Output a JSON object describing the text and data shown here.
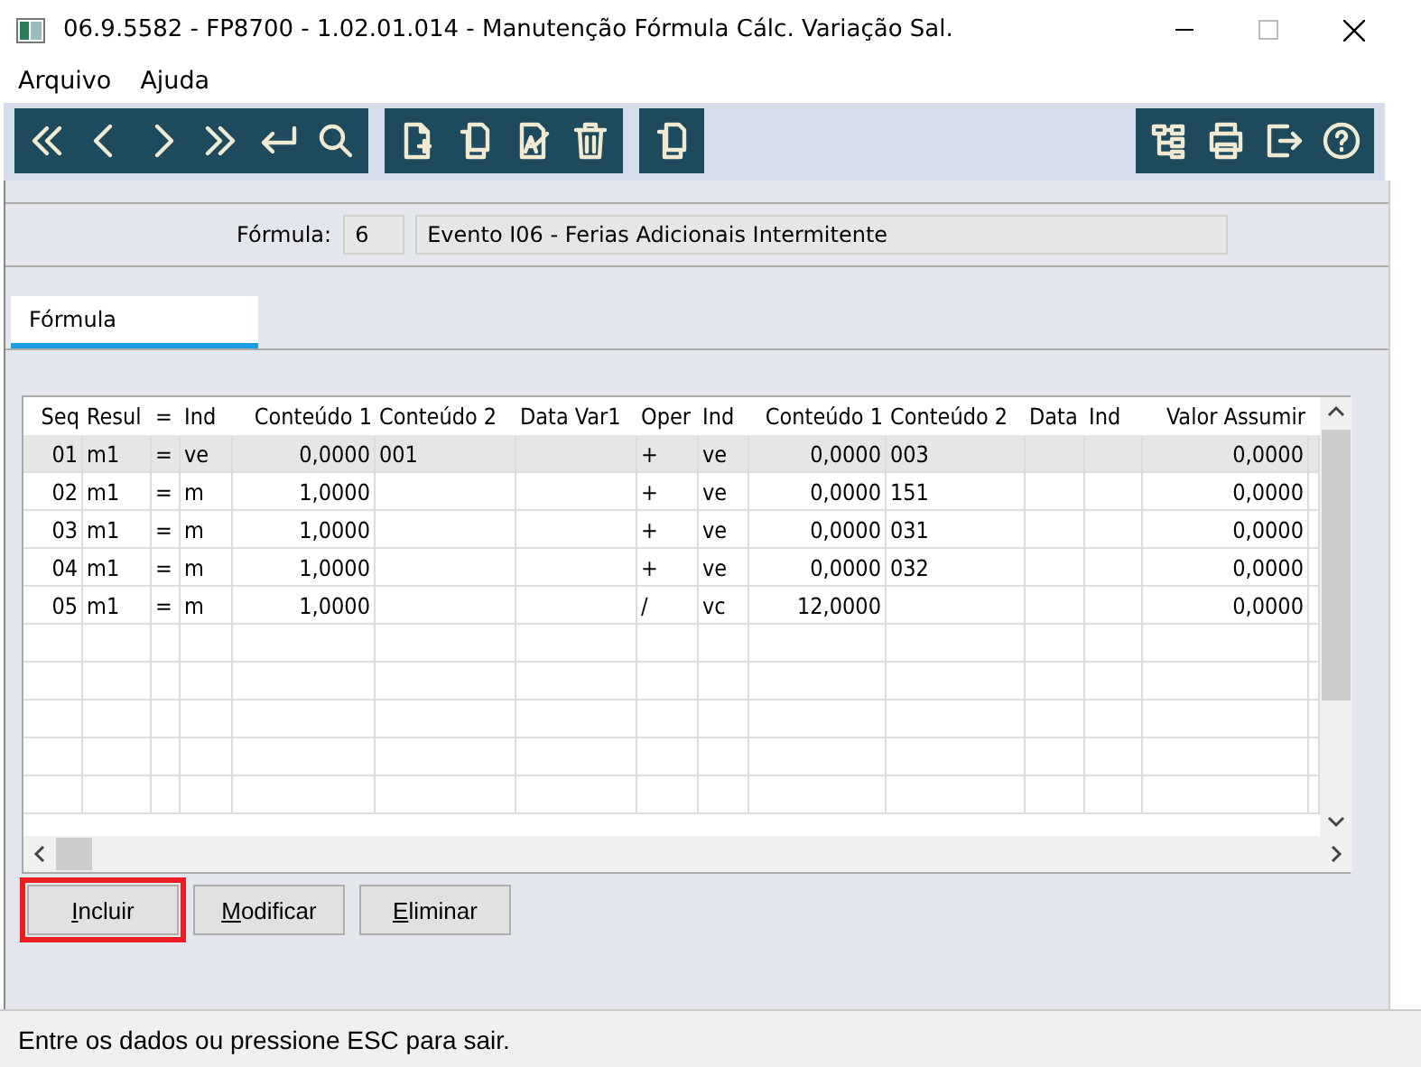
{
  "window": {
    "title": "06.9.5582 - FP8700 - 1.02.01.014 - Manutenção Fórmula Cálc. Variação Sal."
  },
  "menu": [
    "Arquivo",
    "Ajuda"
  ],
  "header": {
    "label": "Fórmula:",
    "code": "6",
    "description": "Evento I06 - Ferias Adicionais Intermitente"
  },
  "tabs": [
    {
      "label": "Fórmula",
      "selected": true
    }
  ],
  "table": {
    "columns": [
      "Seq",
      "Resul",
      "=",
      "Ind",
      "Conteúdo 1",
      "Conteúdo 2",
      "Data Var1",
      "Oper",
      "Ind",
      "Conteúdo 1",
      "Conteúdo 2",
      "Data",
      "Ind",
      "Valor Assumir"
    ],
    "rows": [
      {
        "cells": [
          "01",
          "m1",
          "=",
          "ve",
          "0,0000",
          "001",
          "",
          "+",
          "ve",
          "0,0000",
          "003",
          "",
          "",
          "0,0000"
        ],
        "selected": true
      },
      {
        "cells": [
          "02",
          "m1",
          "=",
          "m",
          "1,0000",
          "",
          "",
          "+",
          "ve",
          "0,0000",
          "151",
          "",
          "",
          "0,0000"
        ],
        "selected": false
      },
      {
        "cells": [
          "03",
          "m1",
          "=",
          "m",
          "1,0000",
          "",
          "",
          "+",
          "ve",
          "0,0000",
          "031",
          "",
          "",
          "0,0000"
        ],
        "selected": false
      },
      {
        "cells": [
          "04",
          "m1",
          "=",
          "m",
          "1,0000",
          "",
          "",
          "+",
          "ve",
          "0,0000",
          "032",
          "",
          "",
          "0,0000"
        ],
        "selected": false
      },
      {
        "cells": [
          "05",
          "m1",
          "=",
          "m",
          "1,0000",
          "",
          "",
          "/",
          "vc",
          "12,0000",
          "",
          "",
          "",
          "0,0000"
        ],
        "selected": false
      }
    ]
  },
  "buttons": [
    {
      "label": "Incluir",
      "highlighted": true
    },
    {
      "label": "Modificar",
      "highlighted": false
    },
    {
      "label": "Eliminar",
      "highlighted": false
    }
  ],
  "status_bar": "Entre os dados ou pressione ESC para sair."
}
